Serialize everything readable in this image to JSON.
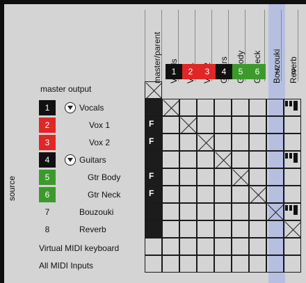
{
  "colors": {
    "red": "#e02626",
    "green": "#3c9a2c",
    "black": "#111111",
    "highlight": "#b7bfe0"
  },
  "header": {
    "column_labels": [
      {
        "label": "master/parent",
        "num": ""
      },
      {
        "label": "Vocals",
        "num": "1"
      },
      {
        "label": "Vox 1",
        "num": "2"
      },
      {
        "label": "Vox 2",
        "num": "3"
      },
      {
        "label": "Guitars",
        "num": "4"
      },
      {
        "label": "Gtr Body",
        "num": "5"
      },
      {
        "label": "Gtr Neck",
        "num": "6"
      },
      {
        "label": "Bouzouki",
        "num": "7"
      },
      {
        "label": "Reverb",
        "num": "8"
      }
    ]
  },
  "source": {
    "axis_label": "source",
    "master_output": "master output",
    "tracks": [
      {
        "num": "1",
        "name": "Vocals",
        "folder": true
      },
      {
        "num": "2",
        "name": "Vox 1",
        "folder": false
      },
      {
        "num": "3",
        "name": "Vox 2",
        "folder": false
      },
      {
        "num": "4",
        "name": "Guitars",
        "folder": true
      },
      {
        "num": "5",
        "name": "Gtr Body",
        "folder": false
      },
      {
        "num": "6",
        "name": "Gtr Neck",
        "folder": false
      },
      {
        "num": "7",
        "name": "Bouzouki",
        "folder": false
      },
      {
        "num": "8",
        "name": "Reverb",
        "folder": false
      }
    ],
    "virtual_midi": "Virtual MIDI keyboard",
    "all_midi": "All MIDI Inputs"
  },
  "grid": {
    "folder_button_label": "F"
  }
}
